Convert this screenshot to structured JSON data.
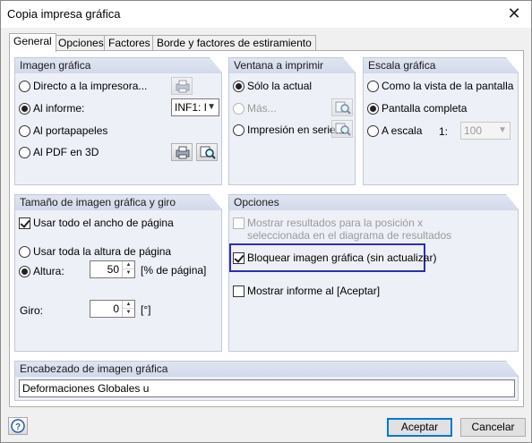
{
  "window": {
    "title": "Copia impresa gráfica"
  },
  "tabs": [
    {
      "label": "General"
    },
    {
      "label": "Opciones"
    },
    {
      "label": "Factores"
    },
    {
      "label": "Borde y factores de estiramiento"
    }
  ],
  "imagen_grafica": {
    "header": "Imagen gráfica",
    "opt_impresora": "Directo a la impresora...",
    "opt_informe": "Al informe:",
    "informe_value": "INF1: I",
    "opt_portapapeles": "Al portapapeles",
    "opt_pdf": "Al PDF en 3D"
  },
  "ventana": {
    "header": "Ventana a imprimir",
    "opt_actual": "Sólo la actual",
    "opt_mas": "Más...",
    "opt_serie": "Impresión en serie..."
  },
  "escala": {
    "header": "Escala gráfica",
    "opt_vista": "Como la vista de la pantalla",
    "opt_completa": "Pantalla completa",
    "opt_escala": "A escala",
    "ratio_label": "1:",
    "ratio_value": "100"
  },
  "tamano": {
    "header": "Tamaño de imagen gráfica y giro",
    "chk_ancho": "Usar todo el ancho de página",
    "opt_altura_total": "Usar toda la altura de página",
    "opt_altura": "Altura:",
    "altura_value": "50",
    "altura_unit": "[% de página]",
    "giro_label": "Giro:",
    "giro_value": "0",
    "giro_unit": "[°]"
  },
  "opciones": {
    "header": "Opciones",
    "chk_resultados_line1": "Mostrar resultados para la posición x",
    "chk_resultados_line2": "seleccionada en el diagrama de resultados",
    "chk_bloquear": "Bloquear imagen gráfica (sin actualizar)",
    "chk_informe": "Mostrar informe al [Aceptar]"
  },
  "encabezado": {
    "header": "Encabezado de imagen gráfica",
    "value": "Deformaciones Globales u"
  },
  "footer": {
    "accept_label": "Aceptar",
    "cancel_label": "Cancelar"
  },
  "icons": [
    "close-icon",
    "printer-settings-icon",
    "zoom-details-icon",
    "help-icon"
  ],
  "colors": {
    "group_bg": "#eef0f7",
    "group_header": "#d2d9eb",
    "highlight": "#2a2fb0",
    "default_button": "#0078d7"
  }
}
